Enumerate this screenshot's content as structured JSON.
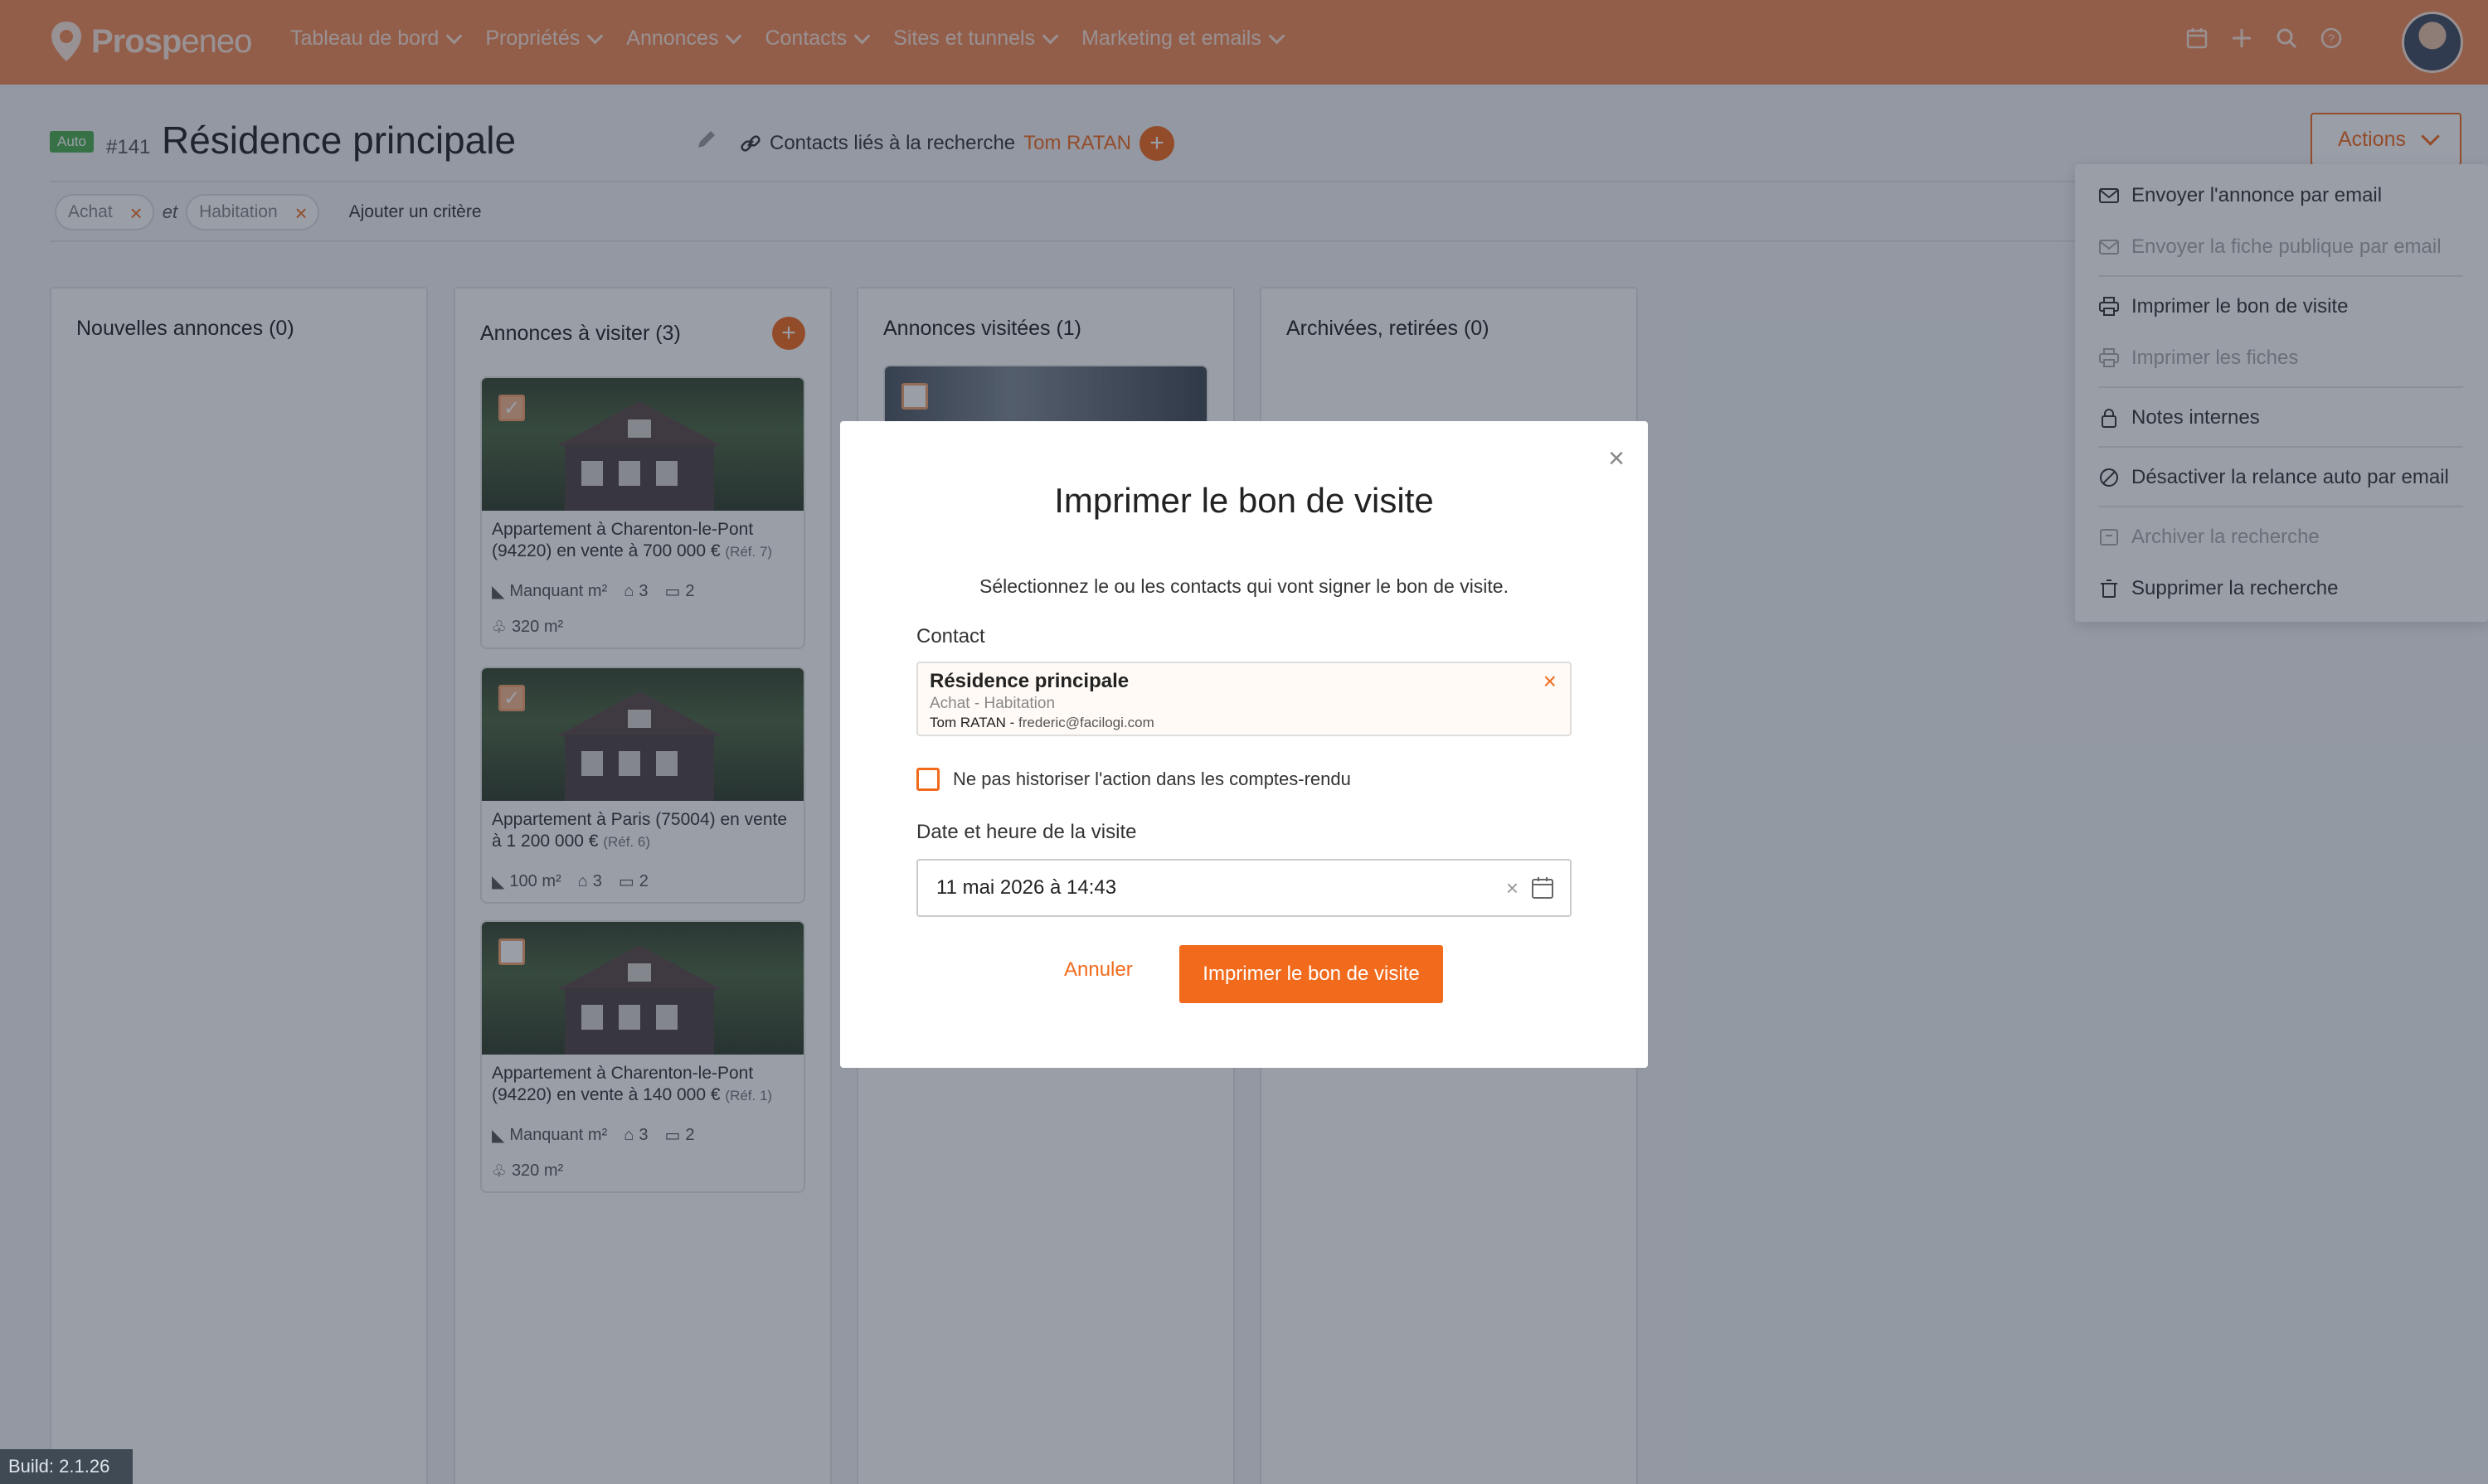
{
  "app": {
    "logo_text_bold": "Prosp",
    "logo_text_light": "eneo",
    "nav": [
      "Tableau de bord",
      "Propriétés",
      "Annonces",
      "Contacts",
      "Sites et tunnels",
      "Marketing et emails"
    ],
    "icons": [
      "calendar-icon",
      "plus-icon",
      "search-icon",
      "help-icon"
    ]
  },
  "header": {
    "badge": "Auto",
    "search_id": "#141",
    "title": "Résidence principale",
    "linked_label": "Contacts liés à la recherche",
    "linked_person": "Tom RATAN",
    "actions_label": "Actions"
  },
  "criteria": {
    "chip1": "Achat",
    "joiner": "et",
    "chip2": "Habitation",
    "add": "Ajouter un critère"
  },
  "columns": [
    {
      "title": "Nouvelles annonces (0)"
    },
    {
      "title": "Annonces à visiter (3)"
    },
    {
      "title": "Annonces visitées (1)"
    },
    {
      "title": "Archivées, retirées (0)"
    }
  ],
  "cards": [
    {
      "title": "Appartement à Charenton-le-Pont (94220) en vente à 700 000 €",
      "ref": "(Réf. 7)",
      "area": "Manquant m²",
      "rooms": "3",
      "beds": "2",
      "land": "320 m²",
      "checked": true
    },
    {
      "title": "Appartement à Paris (75004) en vente à 1 200 000 €",
      "ref": "(Réf. 6)",
      "area": "100 m²",
      "rooms": "3",
      "beds": "2",
      "land": "",
      "checked": true
    },
    {
      "title": "Appartement à Charenton-le-Pont (94220) en vente à 140 000 €",
      "ref": "(Réf. 1)",
      "area": "Manquant m²",
      "rooms": "3",
      "beds": "2",
      "land": "320 m²",
      "checked": false
    }
  ],
  "menu": {
    "items": [
      {
        "label": "Envoyer l'annonce par email",
        "icon": "mail-icon",
        "disabled": false
      },
      {
        "label": "Envoyer la fiche publique par email",
        "icon": "mail-icon",
        "disabled": true
      },
      {
        "label": "Imprimer le bon de visite",
        "icon": "printer-icon",
        "disabled": false
      },
      {
        "label": "Imprimer les fiches",
        "icon": "printer-icon",
        "disabled": true
      },
      {
        "label": "Notes internes",
        "icon": "lock-icon",
        "disabled": false
      },
      {
        "label": "Désactiver la relance auto par email",
        "icon": "ban-icon",
        "disabled": false
      },
      {
        "label": "Archiver la recherche",
        "icon": "archive-icon",
        "disabled": true
      },
      {
        "label": "Supprimer la recherche",
        "icon": "trash-icon",
        "disabled": false
      }
    ]
  },
  "modal": {
    "title": "Imprimer le bon de visite",
    "description": "Sélectionnez le ou les contacts qui vont signer le bon de visite.",
    "contact_label": "Contact",
    "contact_name": "Résidence principale",
    "contact_sub": "Achat - Habitation",
    "contact_person": "Tom RATAN",
    "contact_email": "frederic@facilogi.com",
    "checkbox_label": "Ne pas historiser l'action dans les comptes-rendu",
    "date_label": "Date et heure de la visite",
    "date_value": "11 mai 2026 à 14:43",
    "cancel": "Annuler",
    "submit": "Imprimer le bon de visite"
  },
  "build": "Build: 2.1.26",
  "colors": {
    "brand": "#f26b1d",
    "nav_bg": "#f28a55",
    "auto_badge": "#4caf50"
  }
}
